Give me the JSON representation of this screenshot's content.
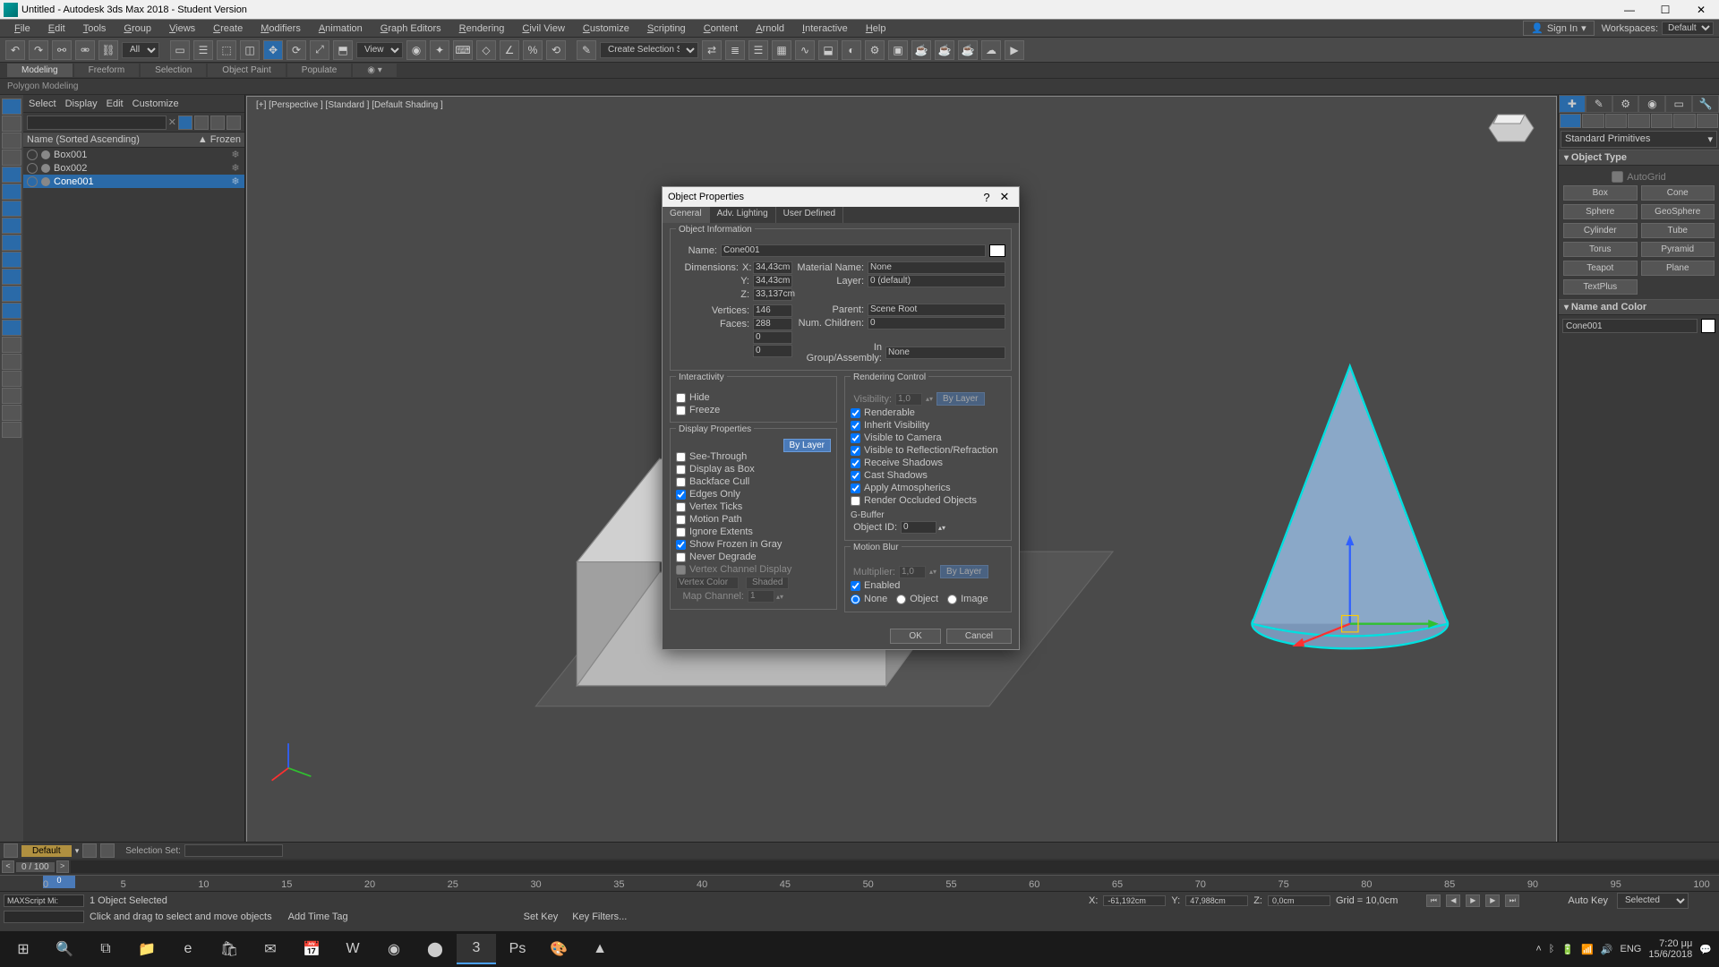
{
  "titlebar": {
    "title": "Untitled - Autodesk 3ds Max 2018 - Student Version"
  },
  "menubar": {
    "items": [
      "File",
      "Edit",
      "Tools",
      "Group",
      "Views",
      "Create",
      "Modifiers",
      "Animation",
      "Graph Editors",
      "Rendering",
      "Civil View",
      "Customize",
      "Scripting",
      "Content",
      "Arnold",
      "Interactive",
      "Help"
    ],
    "signin": "Sign In",
    "workspace_label": "Workspaces:",
    "workspace_value": "Default"
  },
  "maintoolbar": {
    "dropdown1": "All",
    "dropdown2": "View",
    "selset": "Create Selection Se"
  },
  "ribbon": {
    "tabs": [
      "Modeling",
      "Freeform",
      "Selection",
      "Object Paint",
      "Populate"
    ],
    "sub": "Polygon Modeling"
  },
  "explorer": {
    "menu": [
      "Select",
      "Display",
      "Edit",
      "Customize"
    ],
    "col_name": "Name (Sorted Ascending)",
    "col_frozen": "▲ Frozen",
    "items": [
      {
        "name": "Box001",
        "sel": false
      },
      {
        "name": "Box002",
        "sel": false
      },
      {
        "name": "Cone001",
        "sel": true
      }
    ]
  },
  "viewport": {
    "label": "[+] [Perspective ] [Standard ] [Default Shading ]"
  },
  "cmdpanel": {
    "category": "Standard Primitives",
    "rollout_type": "Object Type",
    "autogrid": "AutoGrid",
    "prims": [
      "Box",
      "Cone",
      "Sphere",
      "GeoSphere",
      "Cylinder",
      "Tube",
      "Torus",
      "Pyramid",
      "Teapot",
      "Plane",
      "TextPlus",
      ""
    ],
    "rollout_name": "Name and Color",
    "obj_name": "Cone001"
  },
  "dialog": {
    "title": "Object Properties",
    "tabs": [
      "General",
      "Adv. Lighting",
      "User Defined"
    ],
    "info_title": "Object Information",
    "name_lbl": "Name:",
    "name_val": "Cone001",
    "dim_lbl": "Dimensions:",
    "x_lbl": "X:",
    "x_val": "34,43cm",
    "y_lbl": "Y:",
    "y_val": "34,43cm",
    "z_lbl": "Z:",
    "z_val": "33,137cm",
    "mat_lbl": "Material Name:",
    "mat_val": "None",
    "layer_lbl": "Layer:",
    "layer_val": "0 (default)",
    "verts_lbl": "Vertices:",
    "verts_val": "146",
    "faces_lbl": "Faces:",
    "faces_val": "288",
    "zero1": "0",
    "zero2": "0",
    "parent_lbl": "Parent:",
    "parent_val": "Scene Root",
    "child_lbl": "Num. Children:",
    "child_val": "0",
    "group_lbl": "In Group/Assembly:",
    "group_val": "None",
    "interact_title": "Interactivity",
    "hide": "Hide",
    "freeze": "Freeze",
    "disp_title": "Display Properties",
    "bylayer": "By Layer",
    "see": "See-Through",
    "asbox": "Display as Box",
    "backface": "Backface Cull",
    "edges": "Edges Only",
    "vticks": "Vertex Ticks",
    "mpath": "Motion Path",
    "ignore": "Ignore Extents",
    "frozen": "Show Frozen in Gray",
    "never": "Never Degrade",
    "vchan": "Vertex Channel Display",
    "vcolor": "Vertex Color",
    "shaded": "Shaded",
    "mapch_lbl": "Map Channel:",
    "mapch_val": "1",
    "render_title": "Rendering Control",
    "vis_lbl": "Visibility:",
    "vis_val": "1,0",
    "renderable": "Renderable",
    "inherit": "Inherit Visibility",
    "viscam": "Visible to Camera",
    "visrefl": "Visible to Reflection/Refraction",
    "recvshd": "Receive Shadows",
    "castshd": "Cast Shadows",
    "atmos": "Apply Atmospherics",
    "occluded": "Render Occluded Objects",
    "gbuf_title": "G-Buffer",
    "objid_lbl": "Object ID:",
    "objid_val": "0",
    "mblur_title": "Motion Blur",
    "mult_lbl": "Multiplier:",
    "mult_val": "1,0",
    "enabled": "Enabled",
    "none": "None",
    "object": "Object",
    "image": "Image",
    "ok": "OK",
    "cancel": "Cancel"
  },
  "bottom": {
    "layer": "Default",
    "selset": "Selection Set:",
    "frame": "0 / 100",
    "ticks": [
      "0",
      "5",
      "10",
      "15",
      "20",
      "25",
      "30",
      "35",
      "40",
      "45",
      "50",
      "55",
      "60",
      "65",
      "70",
      "75",
      "80",
      "85",
      "90",
      "95",
      "100"
    ],
    "selcount": "1 Object Selected",
    "hint": "Click and drag to select and move objects",
    "maxscript": "MAXScript Mi:",
    "xl": "X:",
    "xv": "-61,192cm",
    "yl": "Y:",
    "yv": "47,988cm",
    "zl": "Z:",
    "zv": "0,0cm",
    "grid": "Grid = 10,0cm",
    "autokey": "Auto Key",
    "setkey": "Set Key",
    "selected": "Selected",
    "addtag": "Add Time Tag",
    "keyfilters": "Key Filters..."
  },
  "taskbar": {
    "time": "7:20 μμ",
    "date": "15/6/2018",
    "lang": "ENG"
  }
}
